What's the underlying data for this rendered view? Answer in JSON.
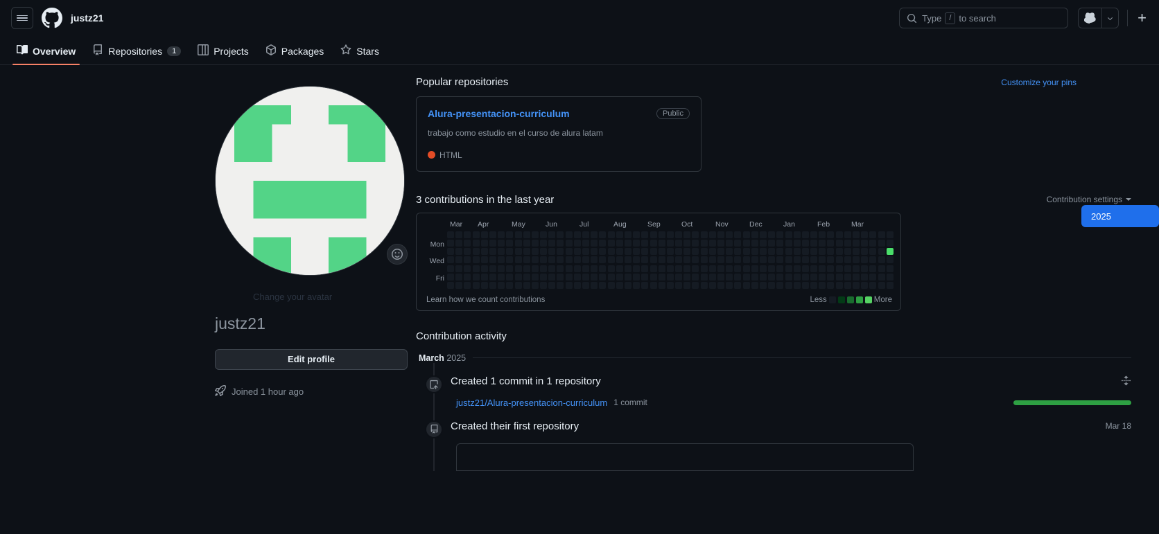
{
  "header": {
    "menu_icon": "hamburger-icon",
    "logo_icon": "github-logo-icon",
    "owner": "justz21",
    "search": {
      "icon": "search-icon",
      "prefix": "Type",
      "key": "/",
      "suffix": "to search"
    },
    "copilot_icon": "copilot-icon",
    "copilot_caret_icon": "chevron-down-icon",
    "plus_label": "+"
  },
  "nav": {
    "items": [
      {
        "label": "Overview",
        "icon": "book-icon",
        "active": true,
        "count": null
      },
      {
        "label": "Repositories",
        "icon": "repo-icon",
        "active": false,
        "count": "1"
      },
      {
        "label": "Projects",
        "icon": "table-icon",
        "active": false,
        "count": null
      },
      {
        "label": "Packages",
        "icon": "package-icon",
        "active": false,
        "count": null
      },
      {
        "label": "Stars",
        "icon": "star-icon",
        "active": false,
        "count": null
      }
    ]
  },
  "profile": {
    "avatar_alt": "avatar-identicon",
    "change_avatar_text": "Change your avatar",
    "emoji_badge_icon": "smiley-icon",
    "name": "justz21",
    "edit_profile_label": "Edit profile",
    "joined_icon": "rocket-icon",
    "joined_text": "Joined 1 hour ago"
  },
  "pins": {
    "title": "Popular repositories",
    "customize_label": "Customize your pins",
    "repos": [
      {
        "name": "Alura-presentacion-curriculum",
        "visibility": "Public",
        "description": "trabajo como estudio en el curso de alura latam",
        "language": "HTML",
        "language_color": "#e34c26"
      }
    ]
  },
  "contributions": {
    "title": "3 contributions in the last year",
    "settings_label": "Contribution settings",
    "settings_caret_icon": "chevron-down-icon",
    "learn_label": "Learn how we count contributions",
    "legend_less": "Less",
    "legend_more": "More",
    "legend_colors": [
      "#151b23",
      "#033a16",
      "#196c2e",
      "#2ea043",
      "#56d364"
    ],
    "year_buttons": [
      "2025"
    ],
    "selected_year": "2025",
    "months": [
      "Mar",
      "Apr",
      "May",
      "Jun",
      "Jul",
      "Aug",
      "Sep",
      "Oct",
      "Nov",
      "Dec",
      "Jan",
      "Feb",
      "Mar"
    ],
    "day_labels": [
      "Mon",
      "Wed",
      "Fri"
    ],
    "chart_data": {
      "type": "heatmap",
      "title": "3 contributions in the last year",
      "weeks": 53,
      "days_per_week": 7,
      "empty_color": "#151b23",
      "filled_cells": [
        {
          "week": 52,
          "day": 2,
          "count": 3,
          "color": "#4ade6a"
        }
      ],
      "scale": [
        {
          "level": 0,
          "color": "#151b23"
        },
        {
          "level": 1,
          "color": "#033a16"
        },
        {
          "level": 2,
          "color": "#196c2e"
        },
        {
          "level": 3,
          "color": "#2ea043"
        },
        {
          "level": 4,
          "color": "#56d364"
        }
      ]
    }
  },
  "activity": {
    "title": "Contribution activity",
    "month_bold": "March",
    "month_year": "2025",
    "items": [
      {
        "icon": "commit-push-icon",
        "heading": "Created 1 commit in 1 repository",
        "expand_icon": "expand-icon",
        "repo_link": "justz21/Alura-presentacion-curriculum",
        "commit_count": "1 commit",
        "bar_color": "#2ea043",
        "date": null
      },
      {
        "icon": "repo-icon",
        "heading": "Created their first repository",
        "expand_icon": null,
        "repo_link": null,
        "commit_count": null,
        "bar_color": null,
        "date": "Mar 18"
      }
    ]
  }
}
